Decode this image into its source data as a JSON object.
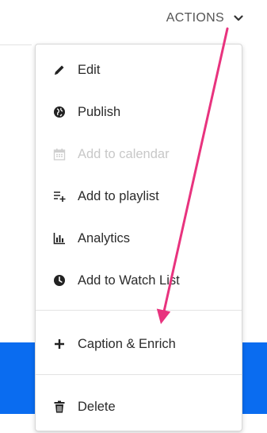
{
  "header": {
    "actions_label": "ACTIONS"
  },
  "menu": {
    "items": [
      {
        "label": "Edit",
        "icon": "pencil-icon",
        "disabled": false
      },
      {
        "label": "Publish",
        "icon": "globe-icon",
        "disabled": false
      },
      {
        "label": "Add to calendar",
        "icon": "calendar-icon",
        "disabled": true
      },
      {
        "label": "Add to playlist",
        "icon": "playlist-add-icon",
        "disabled": false
      },
      {
        "label": "Analytics",
        "icon": "bar-chart-icon",
        "disabled": false
      },
      {
        "label": "Add to Watch List",
        "icon": "clock-icon",
        "disabled": false
      },
      {
        "label": "Caption & Enrich",
        "icon": "plus-icon",
        "disabled": false
      },
      {
        "label": "Delete",
        "icon": "trash-icon",
        "disabled": false
      }
    ]
  },
  "colors": {
    "annotation_arrow": "#e8337e",
    "highlight_bar": "#0a6cf0",
    "disabled_text": "#c8c8c8"
  }
}
